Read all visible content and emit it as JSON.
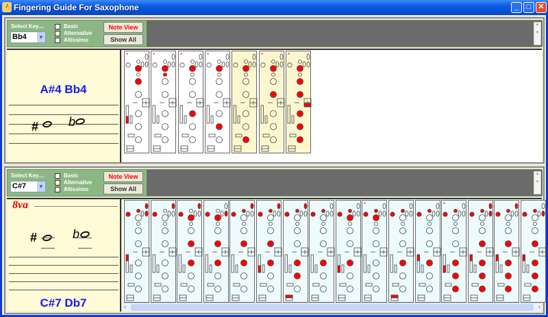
{
  "window": {
    "title": "Fingering Guide For Saxophone",
    "buttons": [
      "_",
      "□",
      "✕"
    ]
  },
  "colors": {
    "basic": "#ffffff",
    "alternative": "#fdf7d0",
    "altissimo": "#eefbfd",
    "closed": "#ff0000"
  },
  "legend": {
    "select_label": "Select Key....",
    "basic": "Basic",
    "alternative": "Alternative",
    "altissimo": "Altissimo"
  },
  "buttons": {
    "note_view": "Note View",
    "show_all": "Show All"
  },
  "panels": [
    {
      "selected_key": "Bb4",
      "note_names": "A#4  Bb4",
      "sharp": "#",
      "flat": "b",
      "ottava": "",
      "fingerings": [
        {
          "type": "basic",
          "star": "*",
          "closed": [
            "B",
            "A",
            "sideLow"
          ]
        },
        {
          "type": "basic",
          "star": "*",
          "closed": [
            "B",
            "bis"
          ]
        },
        {
          "type": "basic",
          "star": "*",
          "closed": [
            "B",
            "F"
          ]
        },
        {
          "type": "basic",
          "star": "*",
          "closed": [
            "B",
            "E"
          ]
        },
        {
          "type": "alternative",
          "star": "",
          "closed": [
            "B",
            "D"
          ]
        },
        {
          "type": "alternative",
          "star": "*",
          "closed": [
            "B",
            "G"
          ]
        },
        {
          "type": "alternative",
          "star": "*",
          "closed": [
            "B",
            "A",
            "G",
            "tbl",
            "F",
            "E",
            "D"
          ]
        }
      ]
    },
    {
      "selected_key": "C#7",
      "note_names": "C#7  Db7",
      "sharp": "#",
      "flat": "b",
      "ottava": "8va",
      "fingerings": [
        {
          "type": "altissimo",
          "star": "",
          "closed": [
            "fF",
            "s",
            "oct",
            "p2",
            "sideTop"
          ]
        },
        {
          "type": "altissimo",
          "star": "",
          "closed": [
            "fF",
            "oct"
          ]
        },
        {
          "type": "altissimo",
          "star": "",
          "closed": [
            "fF",
            "B",
            "oct",
            "G",
            "F"
          ]
        },
        {
          "type": "altissimo",
          "star": "",
          "closed": [
            "fF",
            "B",
            "p2",
            "G",
            "F"
          ]
        },
        {
          "type": "altissimo",
          "star": "",
          "closed": [
            "fF",
            "s",
            "oct",
            "G",
            "F"
          ]
        },
        {
          "type": "altissimo",
          "star": "",
          "closed": [
            "fF",
            "s",
            "oct",
            "G",
            "F",
            "sideLow"
          ]
        },
        {
          "type": "altissimo",
          "star": "",
          "closed": [
            "fF",
            "s",
            "oct",
            "F",
            "E",
            "low"
          ]
        },
        {
          "type": "altissimo",
          "star": "",
          "closed": [
            "fF",
            "s",
            "F"
          ]
        },
        {
          "type": "altissimo",
          "star": "",
          "closed": [
            "fF",
            "s",
            "B",
            "F",
            "sideLow"
          ]
        },
        {
          "type": "altissimo",
          "star": "*",
          "closed": [
            "fF",
            "s",
            "B"
          ]
        },
        {
          "type": "altissimo",
          "star": "",
          "closed": [
            "fF",
            "s",
            "F",
            "low"
          ]
        },
        {
          "type": "altissimo",
          "star": "",
          "closed": [
            "fF",
            "s",
            "sideTop",
            "F"
          ]
        },
        {
          "type": "altissimo",
          "star": "*",
          "closed": [
            "fF",
            "s",
            "sideLow",
            "F",
            "E",
            "D"
          ]
        },
        {
          "type": "altissimo",
          "star": "",
          "closed": [
            "fF",
            "s",
            "oct",
            "p2",
            "G",
            "sideTop",
            "F",
            "E",
            "D"
          ]
        },
        {
          "type": "altissimo",
          "star": "",
          "closed": [
            "fF",
            "s",
            "oct",
            "G",
            "sideTop",
            "F",
            "E",
            "D"
          ]
        },
        {
          "type": "altissimo",
          "star": "",
          "closed": [
            "fF",
            "s",
            "p2",
            "G",
            "sideTop",
            "F",
            "E",
            "D"
          ]
        }
      ]
    }
  ]
}
